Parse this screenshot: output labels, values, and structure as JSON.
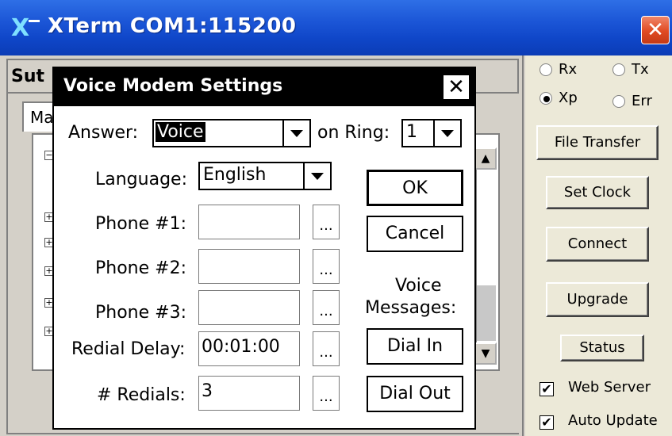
{
  "window": {
    "title": "XTerm COM1:115200",
    "logo_glyph": "X",
    "close_glyph": "✕"
  },
  "background_window": {
    "title_partial": "Sut",
    "tab_partial": "Ma",
    "tree_expanders": [
      "−",
      "+",
      "+",
      "+",
      "+",
      "+"
    ]
  },
  "dialog": {
    "title": "Voice Modem Settings",
    "close_glyph": "✕",
    "answer_label": "Answer:",
    "answer_value": "Voice",
    "on_ring_label": "on Ring:",
    "on_ring_value": "1",
    "language_label": "Language:",
    "language_value": "English",
    "phone1_label": "Phone #1:",
    "phone1_value": "",
    "phone2_label": "Phone #2:",
    "phone2_value": "",
    "phone3_label": "Phone #3:",
    "phone3_value": "",
    "redial_delay_label": "Redial Delay:",
    "redial_delay_value": "00:01:00",
    "redials_label": "# Redials:",
    "redials_value": "3",
    "ellipsis": "...",
    "ok": "OK",
    "cancel": "Cancel",
    "voice_messages_line1": "Voice",
    "voice_messages_line2": "Messages:",
    "dial_in": "Dial In",
    "dial_out": "Dial Out"
  },
  "right_panel": {
    "radio_rx": "Rx",
    "radio_tx": "Tx",
    "radio_xp": "Xp",
    "radio_err": "Err",
    "selected_radio": "Xp",
    "file_transfer": "File Transfer",
    "set_clock": "Set Clock",
    "connect": "Connect",
    "upgrade": "Upgrade",
    "status": "Status",
    "web_server": "Web Server",
    "web_server_checked": true,
    "auto_update": "Auto Update",
    "auto_update_checked": true,
    "check_glyph": "✔"
  }
}
